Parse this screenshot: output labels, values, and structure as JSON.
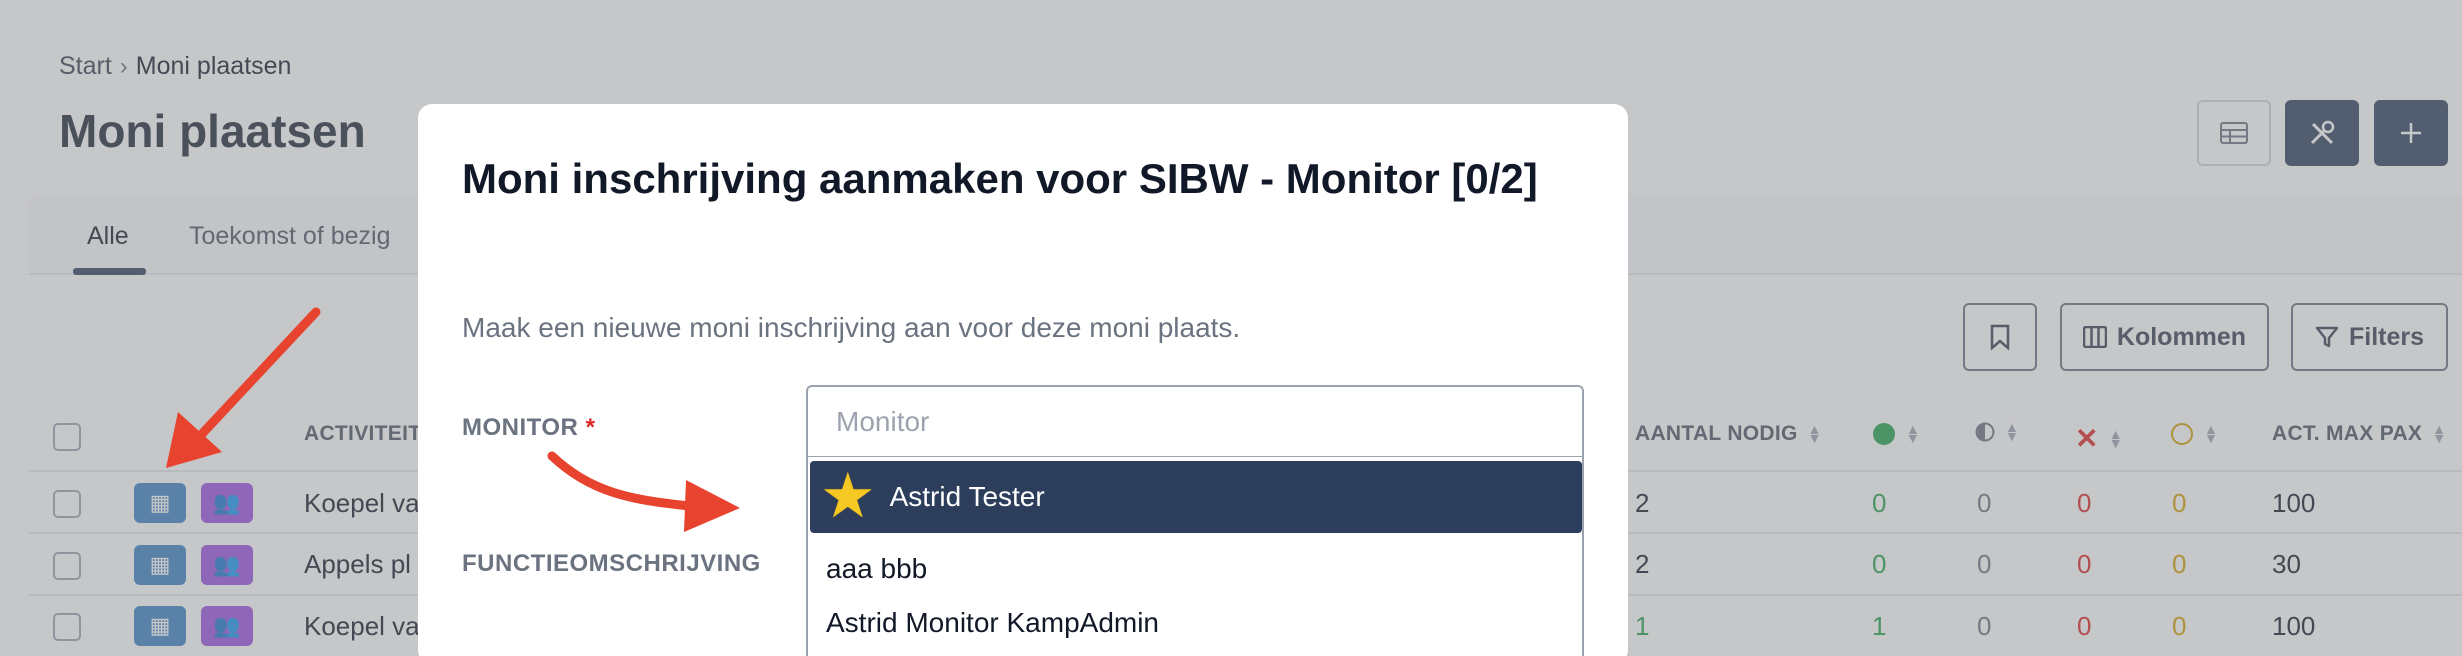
{
  "breadcrumb": {
    "root": "Start",
    "current": "Moni plaatsen"
  },
  "page": {
    "title": "Moni plaatsen"
  },
  "tabs": [
    "Alle",
    "Toekomst of bezig"
  ],
  "toolbar": {
    "columns_label": "Kolommen",
    "filters_label": "Filters"
  },
  "table": {
    "headers": {
      "activity": "ACTIVITEIT",
      "needed": "AANTAL NODIG",
      "max_pax": "ACT. MAX PAX"
    },
    "rows": [
      {
        "activity": "Koepel va",
        "needed": "2",
        "green": "0",
        "half": "0",
        "x": "0",
        "circle": "0",
        "max": "100"
      },
      {
        "activity": "Appels pl",
        "needed": "2",
        "green": "0",
        "half": "0",
        "x": "0",
        "circle": "0",
        "max": "30"
      },
      {
        "activity": "Koepel va",
        "needed": "1",
        "green": "1",
        "half": "0",
        "x": "0",
        "circle": "0",
        "max": "100"
      }
    ]
  },
  "modal": {
    "title": "Moni inschrijving aanmaken voor SIBW - Monitor [0/2]",
    "description": "Maak een nieuwe moni inschrijving aan voor deze moni plaats.",
    "monitor_label": "MONITOR",
    "required_mark": "*",
    "monitor_placeholder": "Monitor",
    "function_label": "FUNCTIEOMSCHRIJVING",
    "options": [
      "Astrid Tester",
      "aaa bbb",
      "Astrid Monitor KampAdmin"
    ]
  },
  "colors": {
    "primary": "#2c3e5c",
    "calendar_button": "#3b82c4",
    "people_button": "#9b51e0",
    "annotation_arrow": "#e8432e",
    "required": "#dc2626"
  }
}
